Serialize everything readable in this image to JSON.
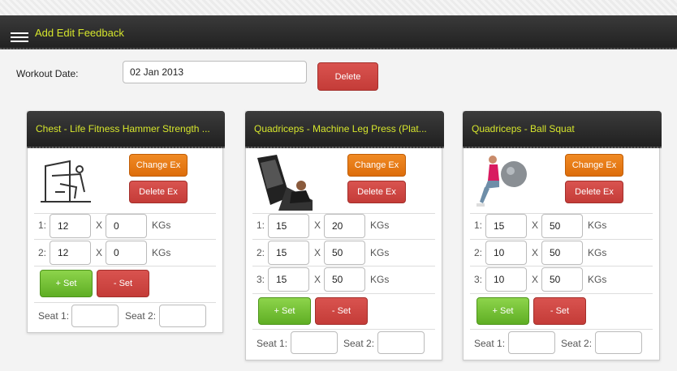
{
  "header": {
    "title": "Add Edit Feedback"
  },
  "workout": {
    "date_label": "Workout Date:",
    "date_value": "02 Jan 2013",
    "delete_label": "Delete"
  },
  "labels": {
    "change": "Change Ex",
    "delete_ex": "Delete Ex",
    "add_set": "+ Set",
    "remove_set": "- Set",
    "seat1": "Seat 1:",
    "seat2": "Seat 2:",
    "x": "X",
    "unit": "KGs"
  },
  "cards": [
    {
      "title": "Chest - Life Fitness Hammer Strength ...",
      "sets": [
        {
          "num": "1:",
          "reps": "12",
          "weight": "0"
        },
        {
          "num": "2:",
          "reps": "12",
          "weight": "0"
        }
      ]
    },
    {
      "title": "Quadriceps - Machine Leg Press (Plat...",
      "sets": [
        {
          "num": "1:",
          "reps": "15",
          "weight": "20"
        },
        {
          "num": "2:",
          "reps": "15",
          "weight": "50"
        },
        {
          "num": "3:",
          "reps": "15",
          "weight": "50"
        }
      ]
    },
    {
      "title": "Quadriceps - Ball Squat",
      "sets": [
        {
          "num": "1:",
          "reps": "15",
          "weight": "50"
        },
        {
          "num": "2:",
          "reps": "10",
          "weight": "50"
        },
        {
          "num": "3:",
          "reps": "10",
          "weight": "50"
        }
      ]
    }
  ]
}
